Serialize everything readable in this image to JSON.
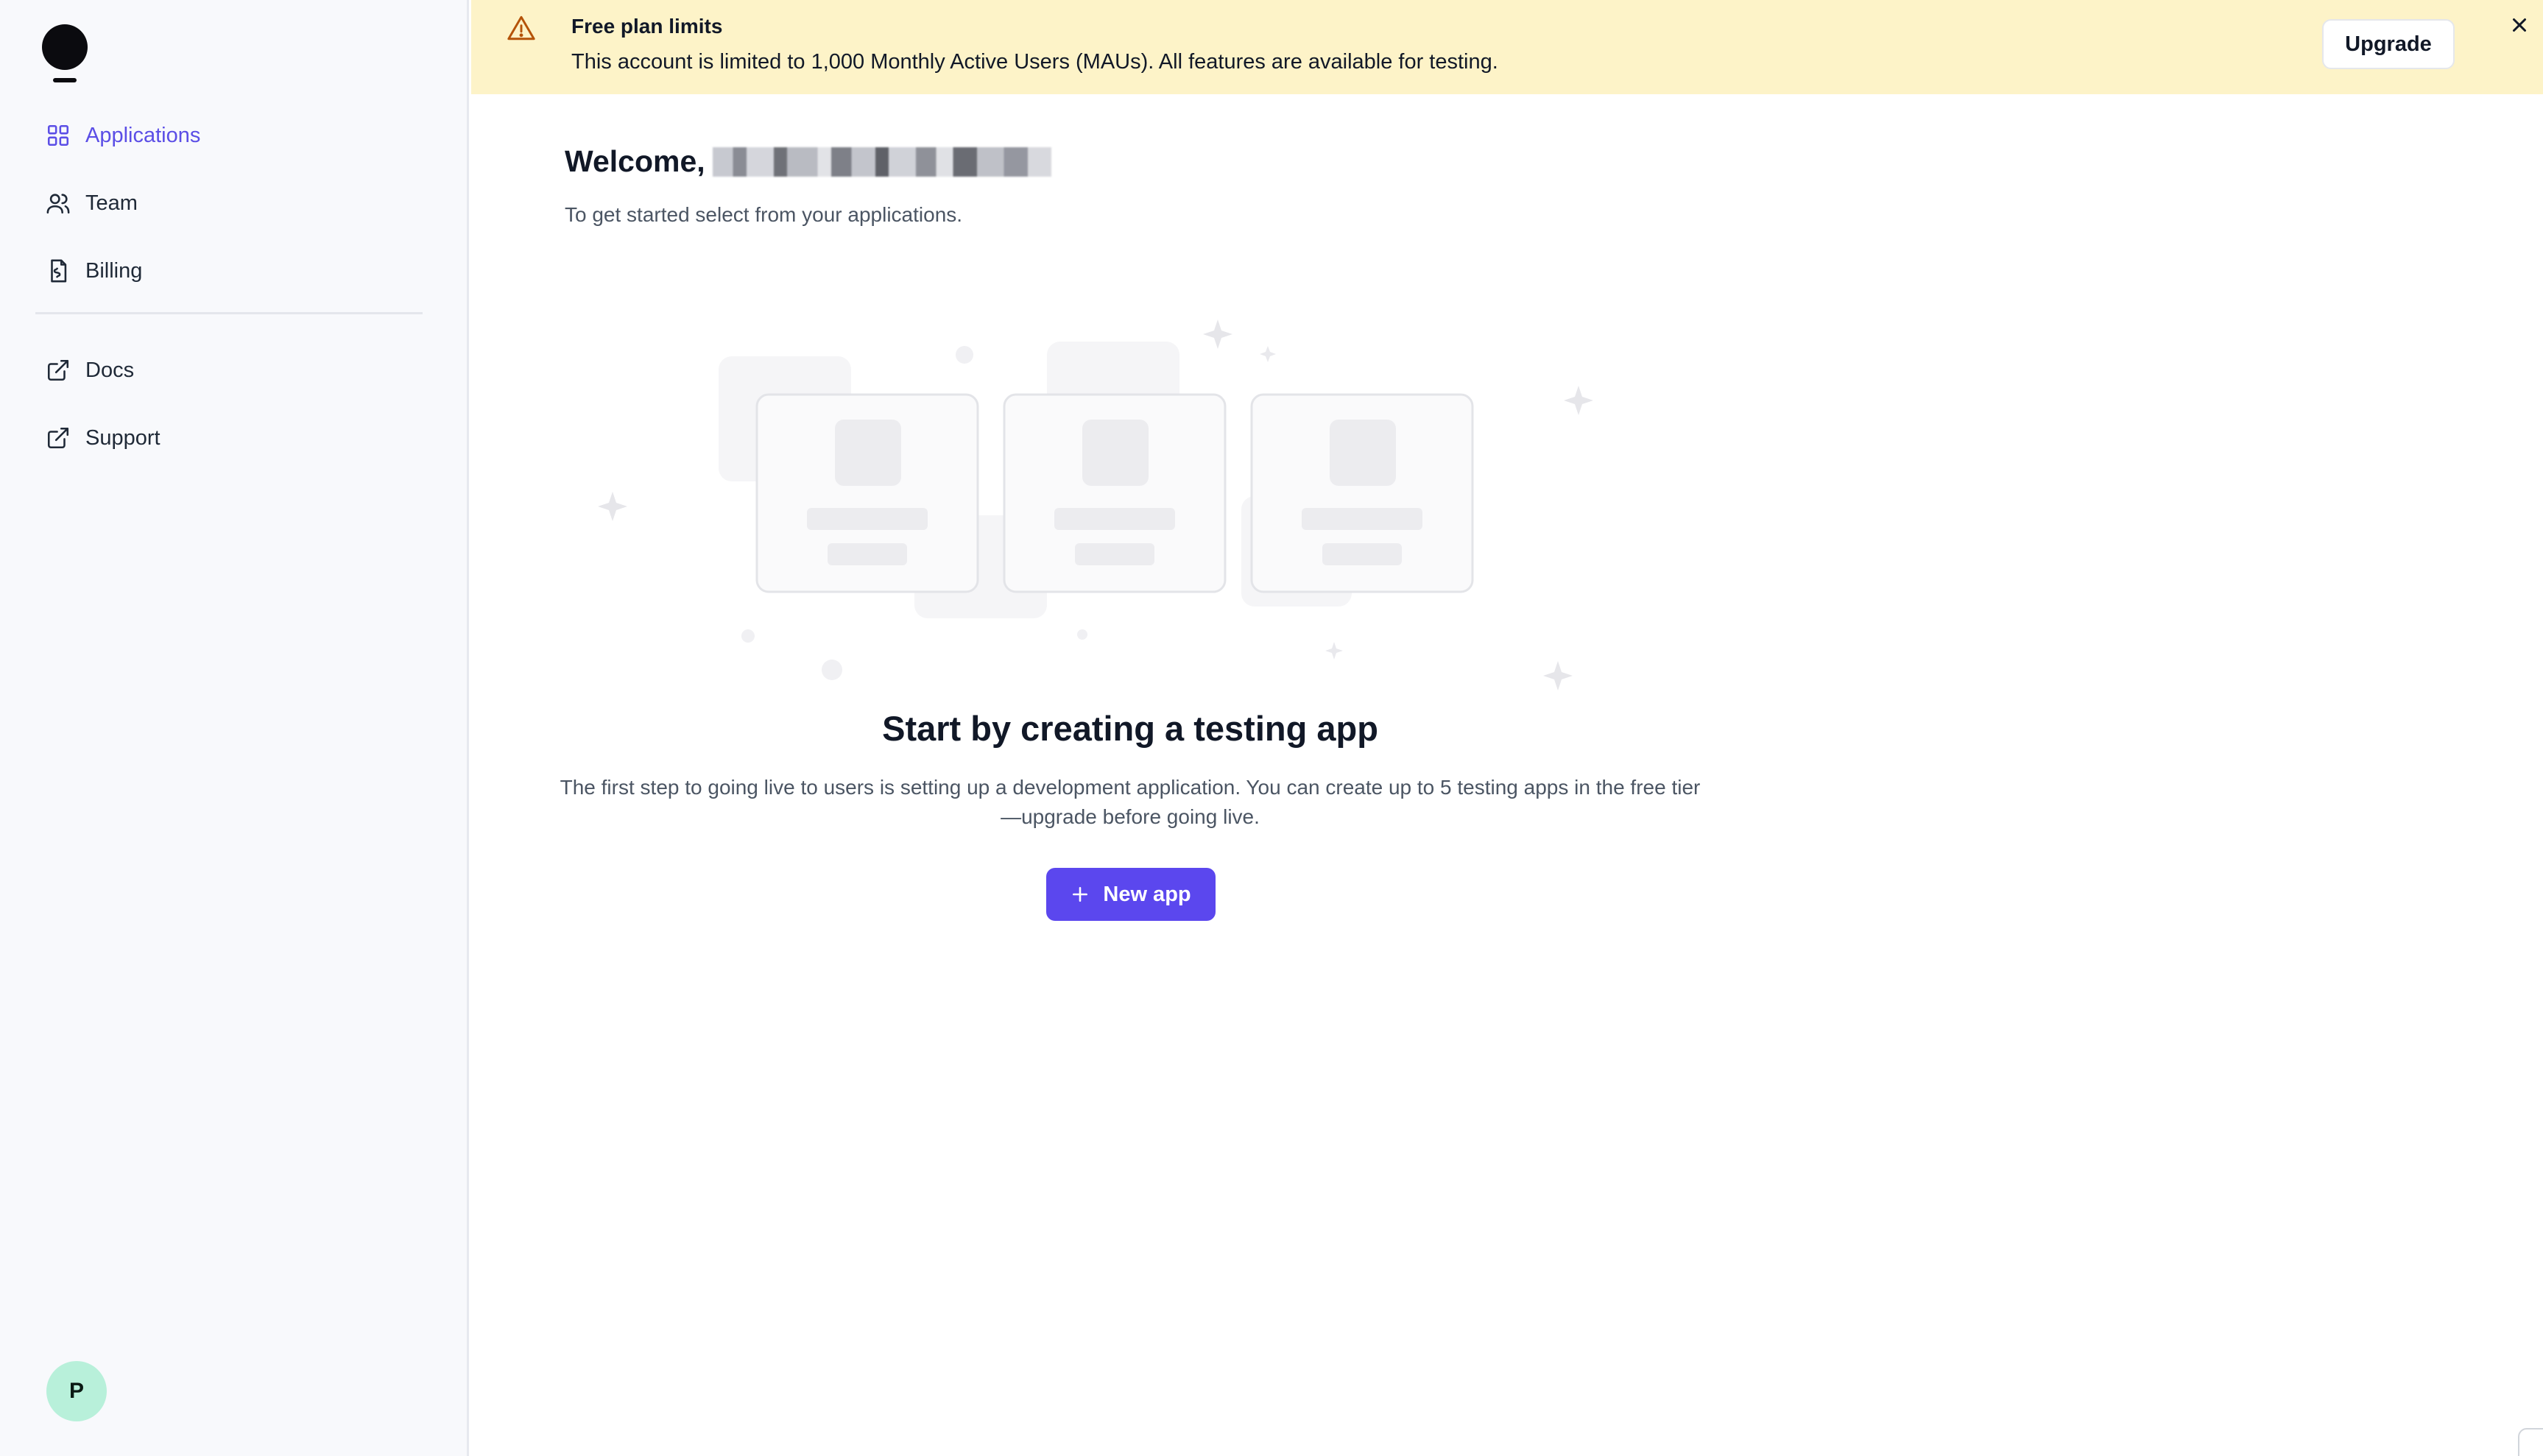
{
  "sidebar": {
    "items": [
      {
        "label": "Applications",
        "icon": "grid-icon",
        "active": true
      },
      {
        "label": "Team",
        "icon": "users-icon",
        "active": false
      },
      {
        "label": "Billing",
        "icon": "receipt-icon",
        "active": false
      },
      {
        "label": "Docs",
        "icon": "external-link-icon",
        "active": false
      },
      {
        "label": "Support",
        "icon": "external-link-icon",
        "active": false
      }
    ],
    "avatar_initial": "P"
  },
  "banner": {
    "title": "Free plan limits",
    "text": "This account is limited to 1,000 Monthly Active Users (MAUs). All features are available for testing.",
    "upgrade_label": "Upgrade",
    "icon": "warning-icon"
  },
  "main": {
    "welcome": "Welcome,",
    "subtitle": "To get started select from your applications.",
    "empty_title": "Start by creating a testing app",
    "empty_description": "The first step to going live to users is setting up a development application. You can create up to 5 testing apps in the free tier—upgrade before going live.",
    "new_app_label": "New app"
  },
  "colors": {
    "accent": "#5b47ee",
    "banner_bg": "#fdf3c8",
    "sidebar_bg": "#f8f9fc",
    "avatar_bg": "#b8f0da"
  }
}
